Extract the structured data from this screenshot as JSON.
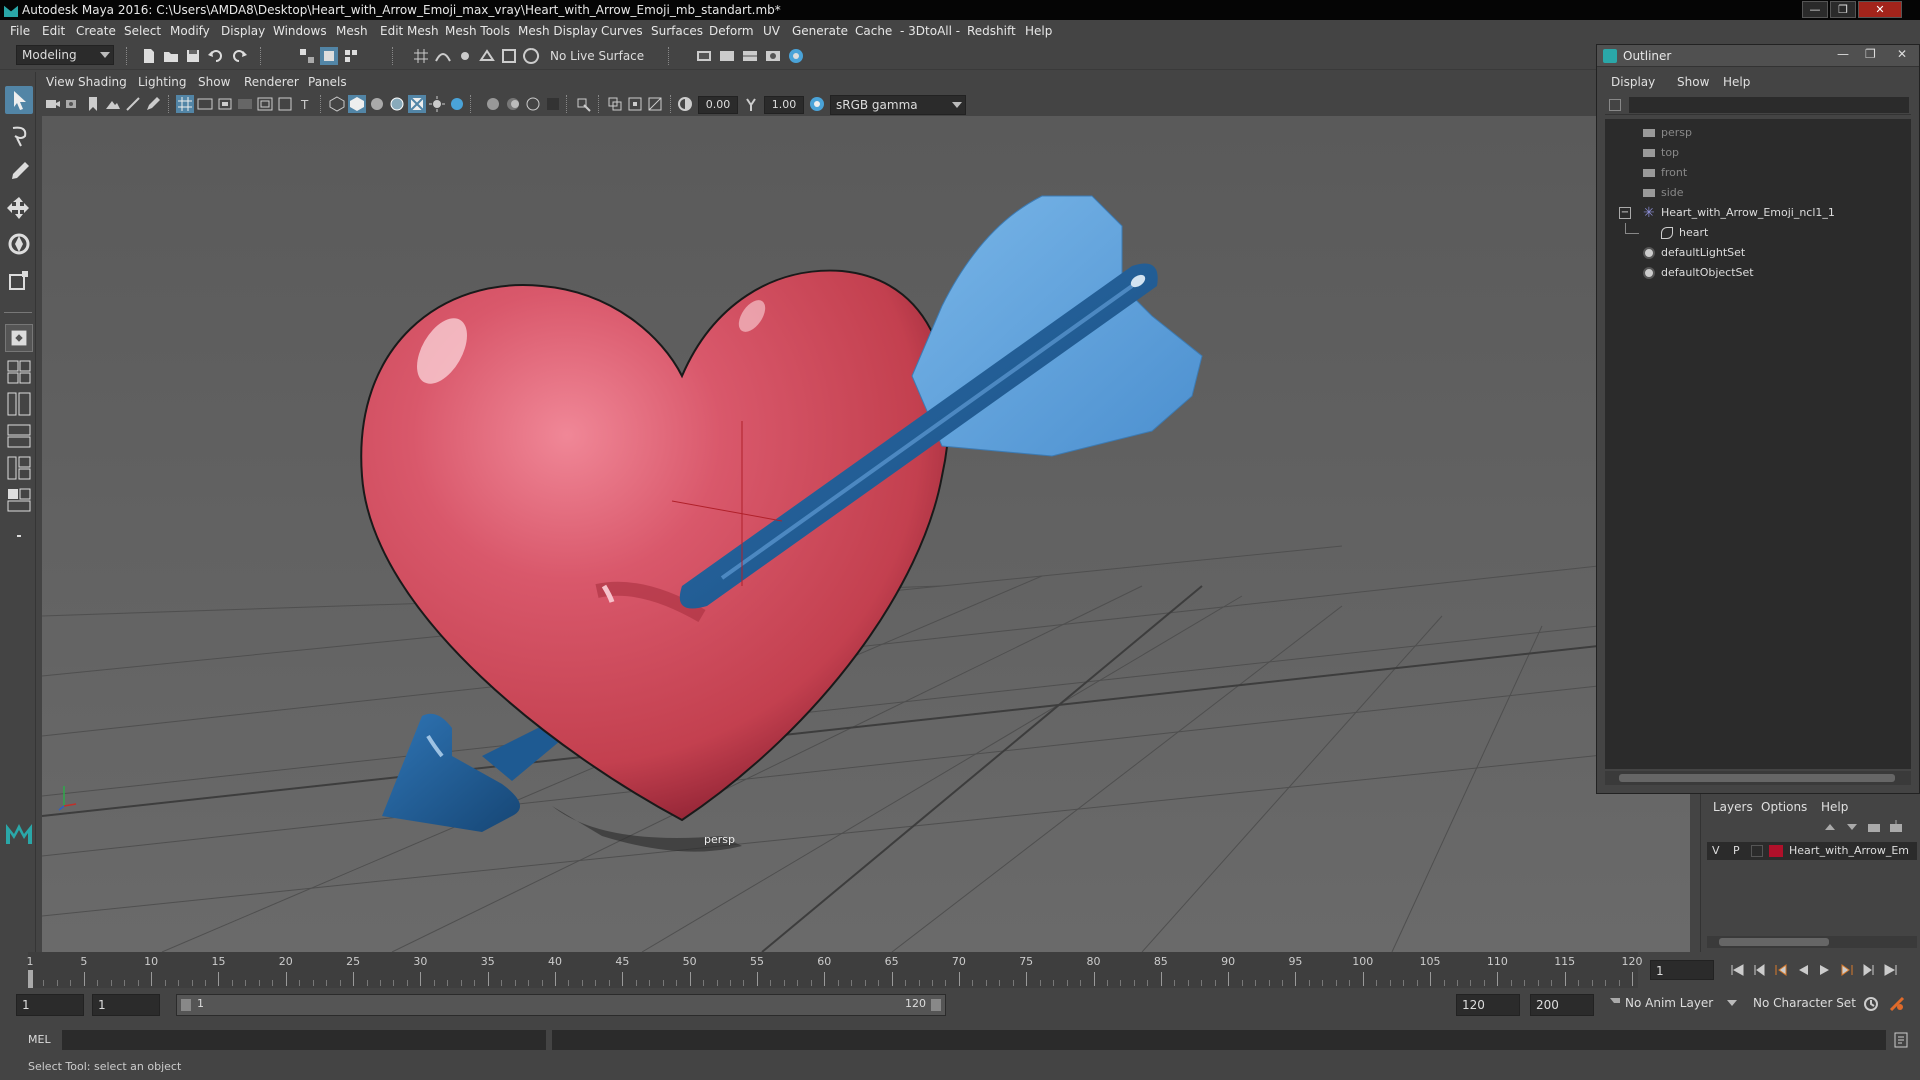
{
  "window": {
    "title": "Autodesk Maya 2016: C:\\Users\\AMDA8\\Desktop\\Heart_with_Arrow_Emoji_max_vray\\Heart_with_Arrow_Emoji_mb_standart.mb*",
    "min": "—",
    "max": "❐",
    "close": "✕"
  },
  "menubar": [
    "File",
    "Edit",
    "Create",
    "Select",
    "Modify",
    "Display",
    "Windows",
    "Mesh",
    "Edit Mesh",
    "Mesh Tools",
    "Mesh Display",
    "Curves",
    "Surfaces",
    "Deform",
    "UV",
    "Generate",
    "Cache",
    "- 3DtoAll -",
    "Redshift",
    "Help"
  ],
  "statusline": {
    "mode": "Modeling",
    "live_surface": "No Live Surface"
  },
  "panel": {
    "menus": [
      "View",
      "Shading",
      "Lighting",
      "Show",
      "Renderer",
      "Panels"
    ],
    "exposure": "0.00",
    "gamma": "1.00",
    "colorspace": "sRGB gamma",
    "camera_label": "persp"
  },
  "outliner": {
    "title": "Outliner",
    "menus": [
      "Display",
      "Show",
      "Help"
    ],
    "items": [
      {
        "label": "persp",
        "icon": "camera-icon",
        "dim": true
      },
      {
        "label": "top",
        "icon": "camera-icon",
        "dim": true
      },
      {
        "label": "front",
        "icon": "camera-icon",
        "dim": true
      },
      {
        "label": "side",
        "icon": "camera-icon",
        "dim": true
      },
      {
        "label": "Heart_with_Arrow_Emoji_ncl1_1",
        "icon": "group-icon",
        "dim": false
      },
      {
        "label": "heart",
        "icon": "mesh-icon",
        "dim": false
      },
      {
        "label": "defaultLightSet",
        "icon": "set-icon",
        "dim": false
      },
      {
        "label": "defaultObjectSet",
        "icon": "set-icon",
        "dim": false
      }
    ],
    "expand_toggle": "−"
  },
  "layers": {
    "menus": [
      "Layers",
      "Options",
      "Help"
    ],
    "row": {
      "v": "V",
      "p": "P",
      "name": "Heart_with_Arrow_Em",
      "color": "#b0102a"
    }
  },
  "timeline": {
    "labels": [
      "1",
      "5",
      "10",
      "15",
      "20",
      "25",
      "30",
      "35",
      "40",
      "45",
      "50",
      "55",
      "60",
      "65",
      "70",
      "75",
      "80",
      "85",
      "90",
      "95",
      "100",
      "105",
      "110",
      "115",
      "120"
    ],
    "current_frame": "1"
  },
  "range": {
    "start": "1",
    "playback_start": "1",
    "range_start_label": "1",
    "range_end_label": "120",
    "playback_end": "120",
    "end": "200",
    "anim_layer": "No Anim Layer",
    "character_set": "No Character Set"
  },
  "cmdline": {
    "label": "MEL"
  },
  "helpline": {
    "text": "Select Tool: select an object"
  },
  "colors": {
    "heart": "#d54a5e",
    "arrow_shaft": "#1f5a91",
    "arrow_fletch": "#5a9fd8",
    "accent": "#5285a6"
  }
}
